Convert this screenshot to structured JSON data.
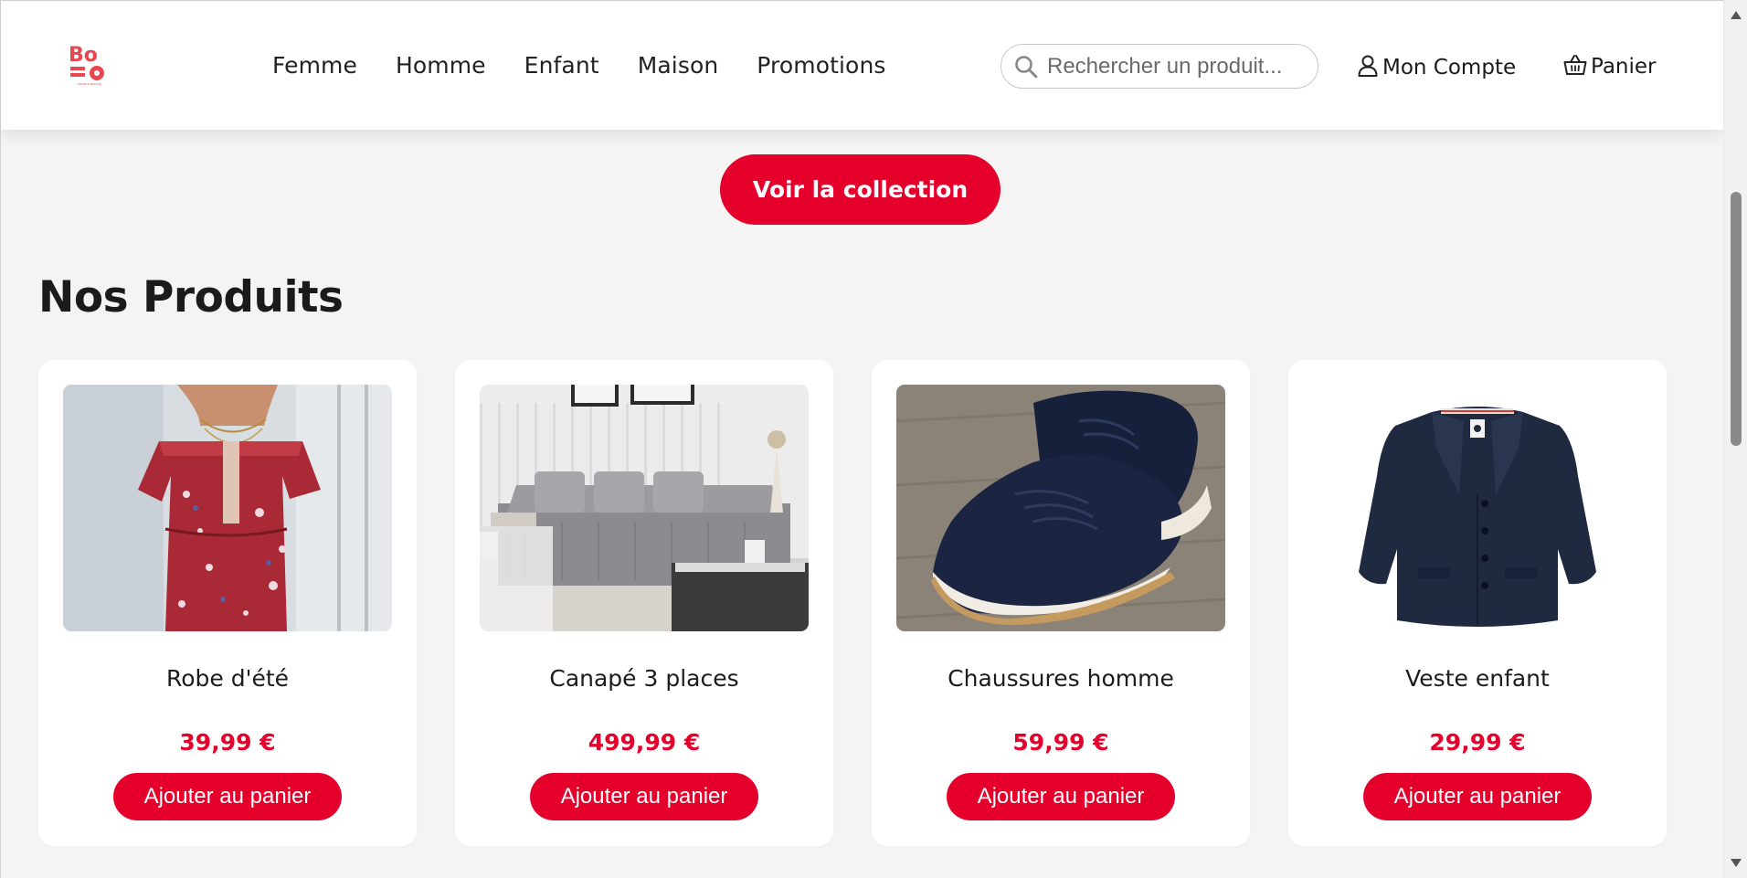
{
  "brand": {
    "logo_text_line1": "Bo",
    "logo_text_line2": "",
    "logo_tagline": "MODE & MAISON",
    "accent_color": "#e4002b"
  },
  "nav": {
    "items": [
      {
        "label": "Femme"
      },
      {
        "label": "Homme"
      },
      {
        "label": "Enfant"
      },
      {
        "label": "Maison"
      },
      {
        "label": "Promotions"
      }
    ]
  },
  "search": {
    "placeholder": "Rechercher un produit...",
    "value": "",
    "icon": "search-icon"
  },
  "account": {
    "label": "Mon Compte",
    "icon": "user-icon"
  },
  "cart": {
    "label": "Panier",
    "icon": "basket-icon"
  },
  "hero": {
    "cta_label": "Voir la collection"
  },
  "products_section": {
    "title": "Nos Produits",
    "items": [
      {
        "name": "Robe d'été",
        "price": "39,99 €",
        "button": "Ajouter au panier",
        "image": "summer-dress-photo"
      },
      {
        "name": "Canapé 3 places",
        "price": "499,99 €",
        "button": "Ajouter au panier",
        "image": "sofa-photo"
      },
      {
        "name": "Chaussures homme",
        "price": "59,99 €",
        "button": "Ajouter au panier",
        "image": "mens-shoes-photo"
      },
      {
        "name": "Veste enfant",
        "price": "29,99 €",
        "button": "Ajouter au panier",
        "image": "kids-jacket-photo"
      }
    ]
  }
}
